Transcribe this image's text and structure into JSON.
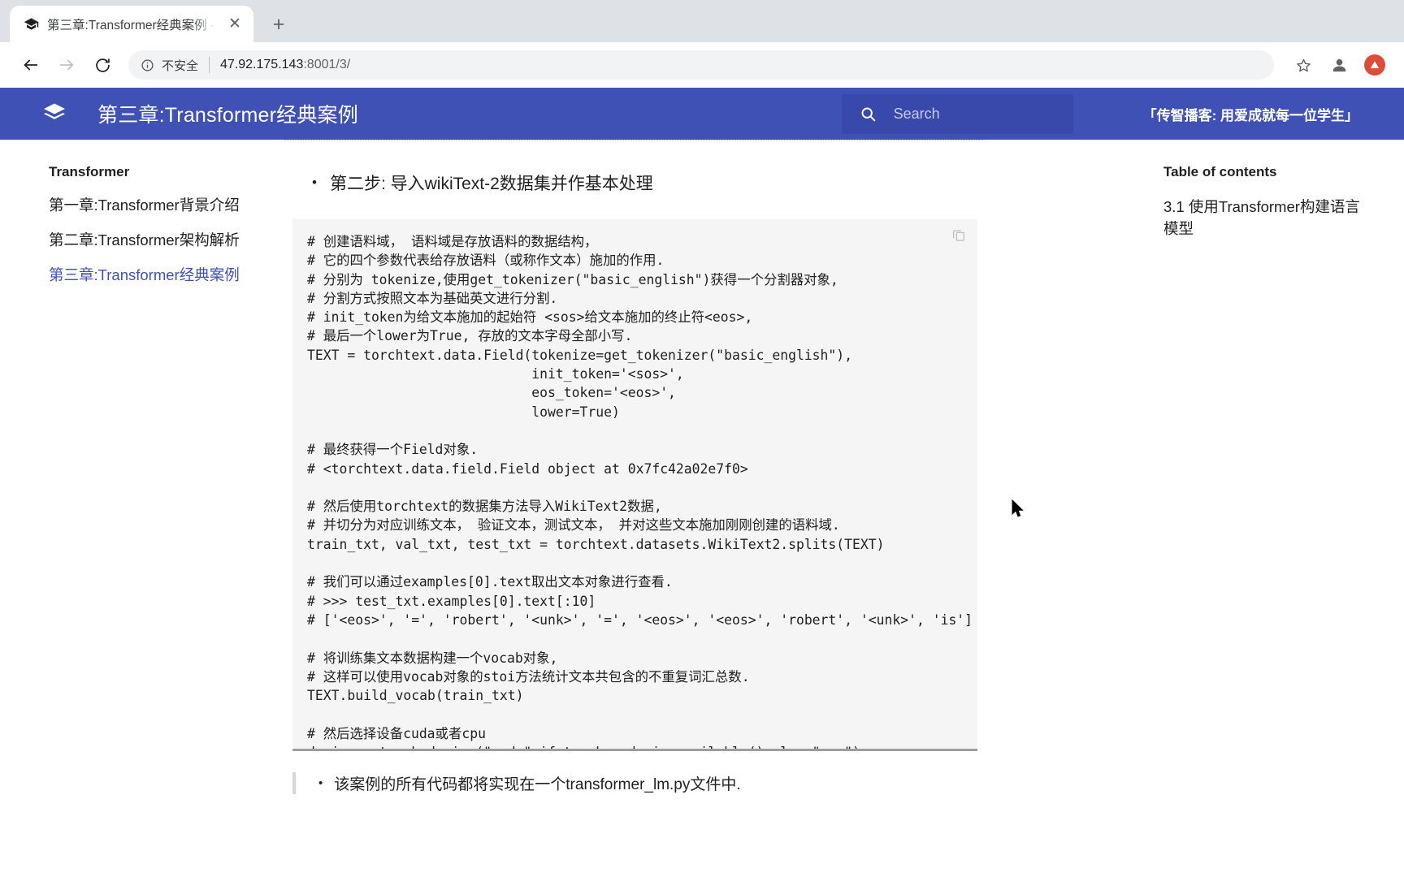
{
  "browser": {
    "tab": {
      "title": "第三章:Transformer经典案例 -",
      "favicon": "graduation-cap-icon",
      "close_label": "✕"
    },
    "new_tab_label": "+",
    "toolbar": {
      "back_label": "←",
      "forward_label": "→",
      "reload_label": "⟳",
      "security_label": "不安全",
      "url_host": "47.92.175.143",
      "url_path": ":8001/3/",
      "bookmark_label": "☆"
    }
  },
  "site_header": {
    "logo": "book-stack-icon",
    "title": "第三章:Transformer经典案例",
    "search_placeholder": "Search",
    "search_value": "",
    "tagline": "「传智播客: 用爱成就每一位学生」",
    "accent_color": "#3f51b5",
    "search_box_color": "#3949ab"
  },
  "left_nav": {
    "title": "Transformer",
    "items": [
      {
        "label": "第一章:Transformer背景介绍",
        "active": false
      },
      {
        "label": "第二章:Transformer架构解析",
        "active": false
      },
      {
        "label": "第三章:Transformer经典案例",
        "active": true
      }
    ]
  },
  "main": {
    "heading_bullet": "•",
    "heading": "第二步: 导入wikiText-2数据集并作基本处理",
    "copy_icon": "copy-icon",
    "code": "# 创建语料域， 语料域是存放语料的数据结构，\n# 它的四个参数代表给存放语料（或称作文本）施加的作用.\n# 分别为 tokenize,使用get_tokenizer(\"basic_english\")获得一个分割器对象,\n# 分割方式按照文本为基础英文进行分割.\n# init_token为给文本施加的起始符 <sos>给文本施加的终止符<eos>,\n# 最后一个lower为True, 存放的文本字母全部小写.\nTEXT = torchtext.data.Field(tokenize=get_tokenizer(\"basic_english\"),\n                            init_token='<sos>',\n                            eos_token='<eos>',\n                            lower=True)\n\n# 最终获得一个Field对象.\n# <torchtext.data.field.Field object at 0x7fc42a02e7f0>\n\n# 然后使用torchtext的数据集方法导入WikiText2数据,\n# 并切分为对应训练文本， 验证文本，测试文本， 并对这些文本施加刚刚创建的语料域.\ntrain_txt, val_txt, test_txt = torchtext.datasets.WikiText2.splits(TEXT)\n\n# 我们可以通过examples[0].text取出文本对象进行查看.\n# >>> test_txt.examples[0].text[:10]\n# ['<eos>', '=', 'robert', '<unk>', '=', '<eos>', '<eos>', 'robert', '<unk>', 'is']\n\n# 将训练集文本数据构建一个vocab对象,\n# 这样可以使用vocab对象的stoi方法统计文本共包含的不重复词汇总数.\nTEXT.build_vocab(train_txt)\n\n# 然后选择设备cuda或者cpu\ndevice = torch.device(\"cuda\" if torch.cuda.is_available() else \"cpu\")",
    "footer_bullet": "•",
    "footer_note": "该案例的所有代码都将实现在一个transformer_lm.py文件中."
  },
  "toc": {
    "title": "Table of contents",
    "items": [
      {
        "label": "3.1 使用Transformer构建语言模型"
      }
    ]
  }
}
